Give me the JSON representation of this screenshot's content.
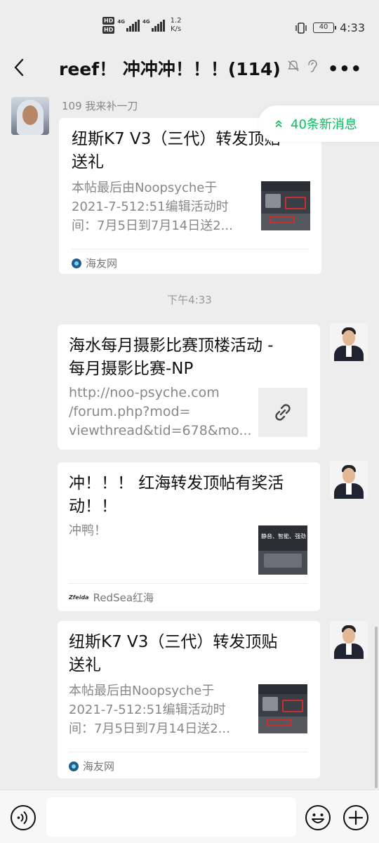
{
  "status_bar": {
    "hd_badge": "HD",
    "network_1": "4G",
    "network_2": "4G",
    "speed_value": "1.2",
    "speed_unit": "K/s",
    "battery": "40",
    "time": "4:33"
  },
  "header": {
    "title": "reef！ 冲冲冲！！！(114)"
  },
  "new_messages_label": "40条新消息",
  "messages": [
    {
      "sender": "109 我来补一刀",
      "title_line1": "纽斯K7 V3（三代）转发顶贴",
      "title_line2": "送礼",
      "desc_line1": "本帖最后由Noopsyche于",
      "desc_line2": "2021-7-512:51编辑活动时",
      "desc_line3": "间：7月5日到7月14日送2...",
      "source": "海友网"
    },
    {
      "timestamp": "下午4:33"
    },
    {
      "title_line1": "海水每月摄影比赛顶楼活动 -",
      "title_line2": "每月摄影比赛-NP",
      "desc_line1": "http://noo-psyche.com",
      "desc_line2": "/forum.php?mod=",
      "desc_line3": "viewthread&tid=678&mo..."
    },
    {
      "title_line1": "冲！！！ 红海转发顶帖有奖活",
      "title_line2": "动！！",
      "desc_line1": "冲鸭！",
      "thumb_text": "静音、智能、强劲",
      "source_logo": "Zfeida",
      "source": "RedSea红海"
    },
    {
      "title_line1": "纽斯K7 V3（三代）转发顶贴",
      "title_line2": "送礼",
      "desc_line1": "本帖最后由Noopsyche于",
      "desc_line2": "2021-7-512:51编辑活动时",
      "desc_line3": "间：7月5日到7月14日送2...",
      "source": "海友网"
    }
  ]
}
